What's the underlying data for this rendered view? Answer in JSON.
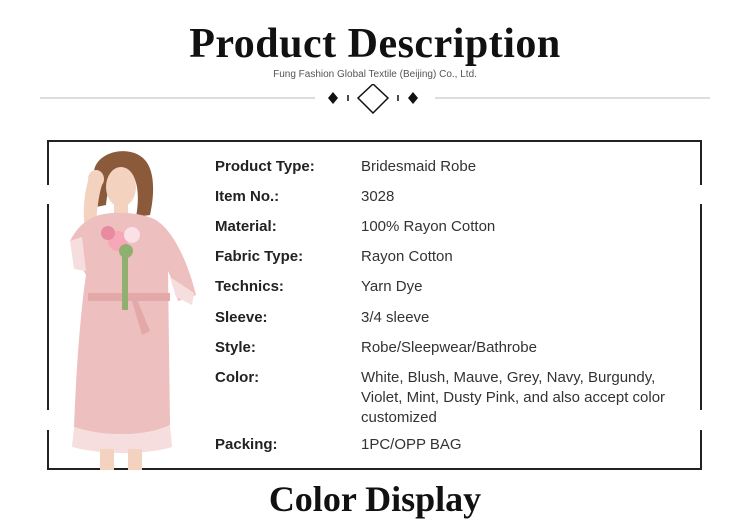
{
  "header": {
    "title": "Product Description",
    "company": "Fung Fashion Global Textile (Beijing) Co., Ltd."
  },
  "specs": [
    {
      "label": "Product Type:",
      "value": "Bridesmaid Robe"
    },
    {
      "label": "Item No.:",
      "value": "3028"
    },
    {
      "label": "Material:",
      "value": "100% Rayon Cotton"
    },
    {
      "label": "Fabric Type:",
      "value": "Rayon Cotton"
    },
    {
      "label": "Technics:",
      "value": "Yarn Dye"
    },
    {
      "label": "Sleeve:",
      "value": "3/4 sleeve"
    },
    {
      "label": "Style:",
      "value": "Robe/Sleepwear/Bathrobe"
    },
    {
      "label": "Color:",
      "value": "White, Blush, Mauve, Grey, Navy, Burgundy, Violet, Mint,  Dusty Pink, and also accept color customized"
    },
    {
      "label": "Packing:",
      "value": "1PC/OPP BAG"
    }
  ],
  "next_section": {
    "title": "Color Display"
  },
  "colors": {
    "robe": "#eebfbf",
    "lace": "#f6dede",
    "hair": "#8a5a3a",
    "skin": "#f3d3c0",
    "frame": "#222222"
  }
}
